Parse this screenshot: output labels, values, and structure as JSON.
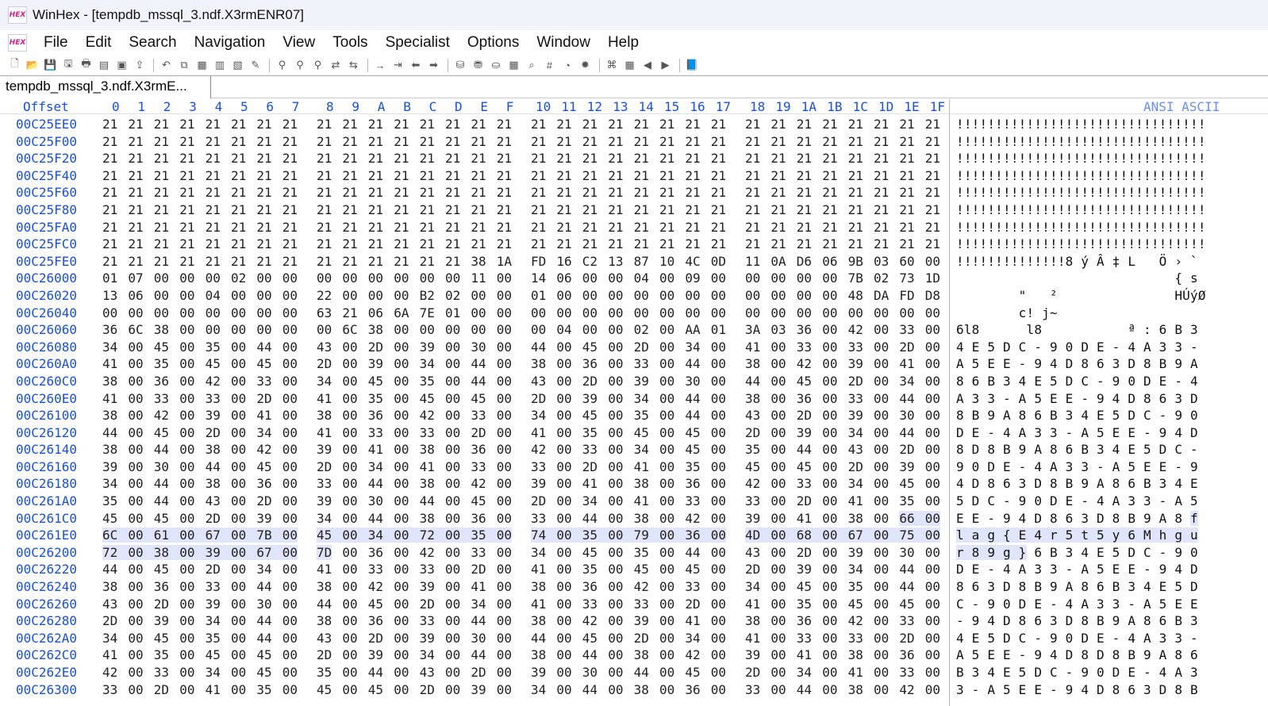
{
  "app": {
    "title": "WinHex - [tempdb_mssql_3.ndf.X3rmENR07]",
    "icon_text": "HEX"
  },
  "menu": [
    "File",
    "Edit",
    "Search",
    "Navigation",
    "View",
    "Tools",
    "Specialist",
    "Options",
    "Window",
    "Help"
  ],
  "toolbar_icons": [
    "new-file-icon",
    "open-folder-icon",
    "save-icon",
    "save-all-icon",
    "print-icon",
    "properties-icon",
    "copy-disk-icon",
    "export-icon",
    "|",
    "undo-icon",
    "copy-icon",
    "copy-block-icon",
    "paste-icon",
    "paste-block-icon",
    "write-icon",
    "|",
    "find-text-icon",
    "find-hex-icon",
    "find-hex-values-icon",
    "replace-text-icon",
    "replace-hex-icon",
    "|",
    "goto-offset-icon",
    "goto-sector-icon",
    "back-icon",
    "forward-icon",
    "|",
    "open-disk-icon",
    "open-ram-icon",
    "open-image-icon",
    "calculator-icon",
    "search-icon",
    "hash-icon",
    "analyze-icon",
    "virus-icon",
    "|",
    "compare-icon",
    "table-icon",
    "prev-icon",
    "next-icon",
    "|",
    "help-book-icon"
  ],
  "tab": {
    "label": "tempdb_mssql_3.ndf.X3rmE..."
  },
  "header": {
    "offset_label": "Offset",
    "columns": [
      "0",
      "1",
      "2",
      "3",
      "4",
      "5",
      "6",
      "7",
      "8",
      "9",
      "A",
      "B",
      "C",
      "D",
      "E",
      "F",
      "10",
      "11",
      "12",
      "13",
      "14",
      "15",
      "16",
      "17",
      "18",
      "19",
      "1A",
      "1B",
      "1C",
      "1D",
      "1E",
      "1F"
    ],
    "ansi_label": "ANSI ASCII"
  },
  "colors": {
    "offset_blue": "#1a4fd7",
    "highlight": "#e1e5fb"
  },
  "rows": [
    {
      "offset": "00C25EE0",
      "bytes": "21 21 21 21 21 21 21 21 21 21 21 21 21 21 21 21 21 21 21 21 21 21 21 21 21 21 21 21 21 21 21 21",
      "ascii": "!!!!!!!!!!!!!!!!!!!!!!!!!!!!!!!!",
      "hl": []
    },
    {
      "offset": "00C25F00",
      "bytes": "21 21 21 21 21 21 21 21 21 21 21 21 21 21 21 21 21 21 21 21 21 21 21 21 21 21 21 21 21 21 21 21",
      "ascii": "!!!!!!!!!!!!!!!!!!!!!!!!!!!!!!!!",
      "hl": []
    },
    {
      "offset": "00C25F20",
      "bytes": "21 21 21 21 21 21 21 21 21 21 21 21 21 21 21 21 21 21 21 21 21 21 21 21 21 21 21 21 21 21 21 21",
      "ascii": "!!!!!!!!!!!!!!!!!!!!!!!!!!!!!!!!",
      "hl": []
    },
    {
      "offset": "00C25F40",
      "bytes": "21 21 21 21 21 21 21 21 21 21 21 21 21 21 21 21 21 21 21 21 21 21 21 21 21 21 21 21 21 21 21 21",
      "ascii": "!!!!!!!!!!!!!!!!!!!!!!!!!!!!!!!!",
      "hl": []
    },
    {
      "offset": "00C25F60",
      "bytes": "21 21 21 21 21 21 21 21 21 21 21 21 21 21 21 21 21 21 21 21 21 21 21 21 21 21 21 21 21 21 21 21",
      "ascii": "!!!!!!!!!!!!!!!!!!!!!!!!!!!!!!!!",
      "hl": []
    },
    {
      "offset": "00C25F80",
      "bytes": "21 21 21 21 21 21 21 21 21 21 21 21 21 21 21 21 21 21 21 21 21 21 21 21 21 21 21 21 21 21 21 21",
      "ascii": "!!!!!!!!!!!!!!!!!!!!!!!!!!!!!!!!",
      "hl": []
    },
    {
      "offset": "00C25FA0",
      "bytes": "21 21 21 21 21 21 21 21 21 21 21 21 21 21 21 21 21 21 21 21 21 21 21 21 21 21 21 21 21 21 21 21",
      "ascii": "!!!!!!!!!!!!!!!!!!!!!!!!!!!!!!!!",
      "hl": []
    },
    {
      "offset": "00C25FC0",
      "bytes": "21 21 21 21 21 21 21 21 21 21 21 21 21 21 21 21 21 21 21 21 21 21 21 21 21 21 21 21 21 21 21 21",
      "ascii": "!!!!!!!!!!!!!!!!!!!!!!!!!!!!!!!!",
      "hl": []
    },
    {
      "offset": "00C25FE0",
      "bytes": "21 21 21 21 21 21 21 21 21 21 21 21 21 21 38 1A FD 16 C2 13 87 10 4C 0D 11 0A D6 06 9B 03 60 00",
      "ascii": "!!!!!!!!!!!!!!8 ý Â ‡ L   Ö › `",
      "hl": []
    },
    {
      "offset": "00C26000",
      "bytes": "01 07 00 00 00 02 00 00 00 00 00 00 00 00 11 00 14 06 00 00 04 00 09 00 00 00 00 00 7B 02 73 1D",
      "ascii": "                            { s",
      "hl": []
    },
    {
      "offset": "00C26020",
      "bytes": "13 06 00 00 04 00 00 00 22 00 00 00 B2 02 00 00 01 00 00 00 00 00 00 00 00 00 00 00 48 DA FD D8",
      "ascii": "        \"   ²               HÚýØ",
      "hl": []
    },
    {
      "offset": "00C26040",
      "bytes": "00 00 00 00 00 00 00 00 63 21 06 6A 7E 01 00 00 00 00 00 00 00 00 00 00 00 00 00 00 00 00 00 00",
      "ascii": "        c! j~",
      "hl": []
    },
    {
      "offset": "00C26060",
      "bytes": "36 6C 38 00 00 00 00 00 00 6C 38 00 00 00 00 00 00 04 00 00 02 00 AA 01 3A 03 36 00 42 00 33 00",
      "ascii": "6l8      l8           ª : 6 B 3",
      "hl": []
    },
    {
      "offset": "00C26080",
      "bytes": "34 00 45 00 35 00 44 00 43 00 2D 00 39 00 30 00 44 00 45 00 2D 00 34 00 41 00 33 00 33 00 2D 00",
      "ascii": "4 E 5 D C - 9 0 D E - 4 A 3 3 -",
      "hl": []
    },
    {
      "offset": "00C260A0",
      "bytes": "41 00 35 00 45 00 45 00 2D 00 39 00 34 00 44 00 38 00 36 00 33 00 44 00 38 00 42 00 39 00 41 00",
      "ascii": "A 5 E E - 9 4 D 8 6 3 D 8 B 9 A",
      "hl": []
    },
    {
      "offset": "00C260C0",
      "bytes": "38 00 36 00 42 00 33 00 34 00 45 00 35 00 44 00 43 00 2D 00 39 00 30 00 44 00 45 00 2D 00 34 00",
      "ascii": "8 6 B 3 4 E 5 D C - 9 0 D E - 4",
      "hl": []
    },
    {
      "offset": "00C260E0",
      "bytes": "41 00 33 00 33 00 2D 00 41 00 35 00 45 00 45 00 2D 00 39 00 34 00 44 00 38 00 36 00 33 00 44 00",
      "ascii": "A 3 3 - A 5 E E - 9 4 D 8 6 3 D",
      "hl": []
    },
    {
      "offset": "00C26100",
      "bytes": "38 00 42 00 39 00 41 00 38 00 36 00 42 00 33 00 34 00 45 00 35 00 44 00 43 00 2D 00 39 00 30 00",
      "ascii": "8 B 9 A 8 6 B 3 4 E 5 D C - 9 0",
      "hl": []
    },
    {
      "offset": "00C26120",
      "bytes": "44 00 45 00 2D 00 34 00 41 00 33 00 33 00 2D 00 41 00 35 00 45 00 45 00 2D 00 39 00 34 00 44 00",
      "ascii": "D E - 4 A 3 3 - A 5 E E - 9 4 D",
      "hl": []
    },
    {
      "offset": "00C26140",
      "bytes": "38 00 44 00 38 00 42 00 39 00 41 00 38 00 36 00 42 00 33 00 34 00 45 00 35 00 44 00 43 00 2D 00",
      "ascii": "8 D 8 B 9 A 8 6 B 3 4 E 5 D C -",
      "hl": []
    },
    {
      "offset": "00C26160",
      "bytes": "39 00 30 00 44 00 45 00 2D 00 34 00 41 00 33 00 33 00 2D 00 41 00 35 00 45 00 45 00 2D 00 39 00",
      "ascii": "9 0 D E - 4 A 3 3 - A 5 E E - 9",
      "hl": []
    },
    {
      "offset": "00C26180",
      "bytes": "34 00 44 00 38 00 36 00 33 00 44 00 38 00 42 00 39 00 41 00 38 00 36 00 42 00 33 00 34 00 45 00",
      "ascii": "4 D 8 6 3 D 8 B 9 A 8 6 B 3 4 E",
      "hl": []
    },
    {
      "offset": "00C261A0",
      "bytes": "35 00 44 00 43 00 2D 00 39 00 30 00 44 00 45 00 2D 00 34 00 41 00 33 00 33 00 2D 00 41 00 35 00",
      "ascii": "5 D C - 9 0 D E - 4 A 3 3 - A 5",
      "hl": []
    },
    {
      "offset": "00C261C0",
      "bytes": "45 00 45 00 2D 00 39 00 34 00 44 00 38 00 36 00 33 00 44 00 38 00 42 00 39 00 41 00 38 00 66 00",
      "ascii": "E E - 9 4 D 8 6 3 D 8 B 9 A 8 f",
      "hl": [
        30,
        31
      ]
    },
    {
      "offset": "00C261E0",
      "bytes": "6C 00 61 00 67 00 7B 00 45 00 34 00 72 00 35 00 74 00 35 00 79 00 36 00 4D 00 68 00 67 00 75 00",
      "ascii": "l a g { E 4 r 5 t 5 y 6 M h g u",
      "hl": [
        0,
        1,
        2,
        3,
        4,
        5,
        6,
        7,
        8,
        9,
        10,
        11,
        12,
        13,
        14,
        15,
        16,
        17,
        18,
        19,
        20,
        21,
        22,
        23,
        24,
        25,
        26,
        27,
        28,
        29,
        30,
        31
      ]
    },
    {
      "offset": "00C26200",
      "bytes": "72 00 38 00 39 00 67 00 7D 00 36 00 42 00 33 00 34 00 45 00 35 00 44 00 43 00 2D 00 39 00 30 00",
      "ascii": "r 8 9 g } 6 B 3 4 E 5 D C - 9 0",
      "hl": [
        0,
        1,
        2,
        3,
        4,
        5,
        6,
        7,
        8
      ]
    },
    {
      "offset": "00C26220",
      "bytes": "44 00 45 00 2D 00 34 00 41 00 33 00 33 00 2D 00 41 00 35 00 45 00 45 00 2D 00 39 00 34 00 44 00",
      "ascii": "D E - 4 A 3 3 - A 5 E E - 9 4 D",
      "hl": []
    },
    {
      "offset": "00C26240",
      "bytes": "38 00 36 00 33 00 44 00 38 00 42 00 39 00 41 00 38 00 36 00 42 00 33 00 34 00 45 00 35 00 44 00",
      "ascii": "8 6 3 D 8 B 9 A 8 6 B 3 4 E 5 D",
      "hl": []
    },
    {
      "offset": "00C26260",
      "bytes": "43 00 2D 00 39 00 30 00 44 00 45 00 2D 00 34 00 41 00 33 00 33 00 2D 00 41 00 35 00 45 00 45 00",
      "ascii": "C - 9 0 D E - 4 A 3 3 - A 5 E E",
      "hl": []
    },
    {
      "offset": "00C26280",
      "bytes": "2D 00 39 00 34 00 44 00 38 00 36 00 33 00 44 00 38 00 42 00 39 00 41 00 38 00 36 00 42 00 33 00",
      "ascii": "- 9 4 D 8 6 3 D 8 B 9 A 8 6 B 3",
      "hl": []
    },
    {
      "offset": "00C262A0",
      "bytes": "34 00 45 00 35 00 44 00 43 00 2D 00 39 00 30 00 44 00 45 00 2D 00 34 00 41 00 33 00 33 00 2D 00",
      "ascii": "4 E 5 D C - 9 0 D E - 4 A 3 3 -",
      "hl": []
    },
    {
      "offset": "00C262C0",
      "bytes": "41 00 35 00 45 00 45 00 2D 00 39 00 34 00 44 00 38 00 44 00 38 00 42 00 39 00 41 00 38 00 36 00",
      "ascii": "A 5 E E - 9 4 D 8 D 8 B 9 A 8 6",
      "hl": []
    },
    {
      "offset": "00C262E0",
      "bytes": "42 00 33 00 34 00 45 00 35 00 44 00 43 00 2D 00 39 00 30 00 44 00 45 00 2D 00 34 00 41 00 33 00",
      "ascii": "B 3 4 E 5 D C - 9 0 D E - 4 A 3",
      "hl": []
    },
    {
      "offset": "00C26300",
      "bytes": "33 00 2D 00 41 00 35 00 45 00 45 00 2D 00 39 00 34 00 44 00 38 00 36 00 33 00 44 00 38 00 42 00",
      "ascii": "3 - A 5 E E - 9 4 D 8 6 3 D 8 B",
      "hl": []
    }
  ]
}
